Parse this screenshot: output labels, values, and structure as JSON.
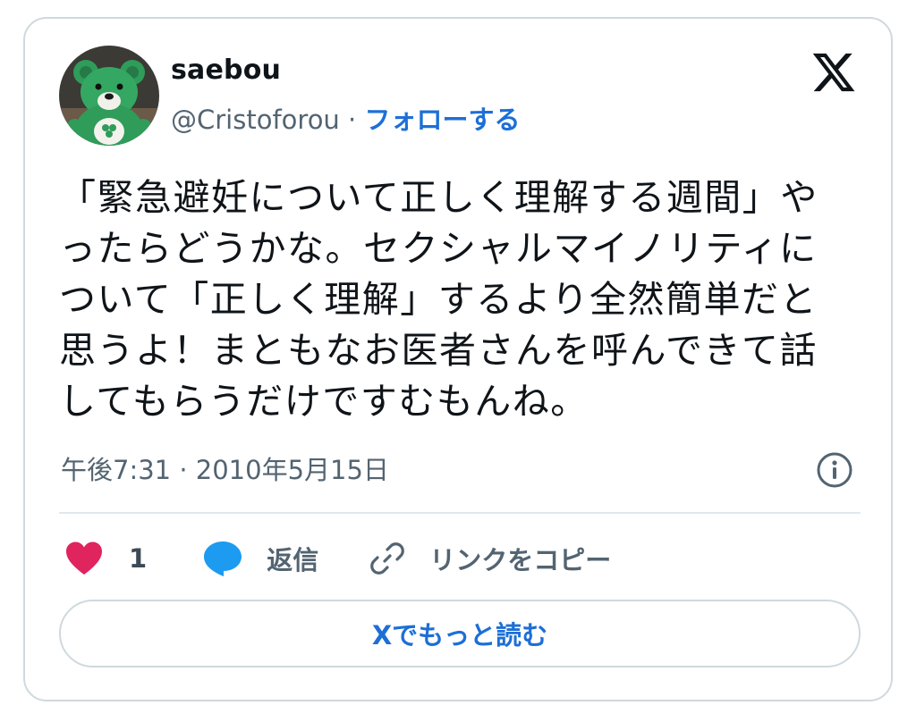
{
  "user": {
    "display_name": "saebou",
    "handle": "@Cristoforou",
    "separator": "·",
    "follow_label": "フォローする",
    "avatar_icon": "green-teddy-bear-avatar"
  },
  "brand": {
    "logo_icon": "x-logo-icon"
  },
  "tweet": {
    "text": "「緊急避妊について正しく理解する週間」やったらどうかな。セクシャルマイノリティについて「正しく理解」するより全然簡単だと思うよ！まともなお医者さんを呼んできて話してもらうだけですむもんね。",
    "timestamp": "午後7:31 · 2010年5月15日"
  },
  "actions": {
    "like_count": "1",
    "reply_label": "返信",
    "copy_link_label": "リンクをコピー"
  },
  "footer": {
    "read_more_label": "Xでもっと読む"
  },
  "colors": {
    "accent": "#1d6fd6",
    "like": "#e0245e",
    "reply": "#1d9bf0",
    "muted": "#536471",
    "border": "#cfd9de"
  }
}
